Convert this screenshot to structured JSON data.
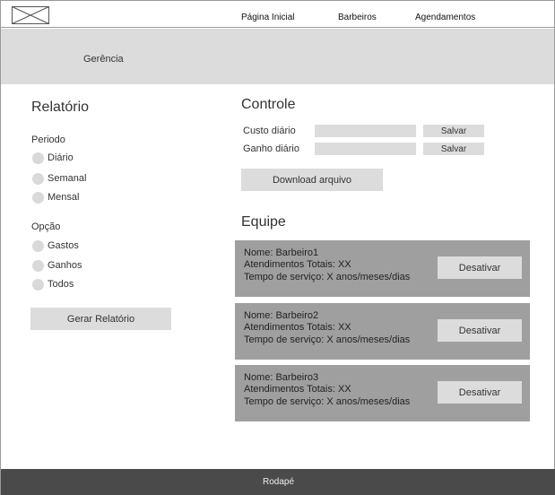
{
  "nav": {
    "links": [
      "Página Inicial",
      "Barbeiros",
      "Agendamentos"
    ]
  },
  "banner": {
    "title": "Gerência"
  },
  "report": {
    "title": "Relatório",
    "period_label": "Periodo",
    "period_options": [
      "Diário",
      "Semanal",
      "Mensal"
    ],
    "option_label": "Opção",
    "option_options": [
      "Gastos",
      "Ganhos",
      "Todos"
    ],
    "generate_button": "Gerar Relatório"
  },
  "control": {
    "title": "Controle",
    "daily_cost_label": "Custo diário",
    "daily_gain_label": "Ganho diário",
    "save_label": "Salvar",
    "download_button": "Download arquivo"
  },
  "team": {
    "title": "Equipe",
    "members": [
      {
        "name": "Nome: Barbeiro1",
        "attendances": "Atendimentos Totais: XX",
        "service_time": "Tempo de serviço: X anos/meses/dias",
        "button": "Desativar"
      },
      {
        "name": "Nome: Barbeiro2",
        "attendances": "Atendimentos Totais: XX",
        "service_time": "Tempo de serviço: X anos/meses/dias",
        "button": "Desativar"
      },
      {
        "name": "Nome: Barbeiro3",
        "attendances": "Atendimentos Totais: XX",
        "service_time": "Tempo de serviço: X anos/meses/dias",
        "button": "Desativar"
      }
    ]
  },
  "footer": {
    "text": "Rodapé"
  },
  "colors": {
    "placeholder_gray": "#dcdcdc",
    "card_gray": "#9f9f9f",
    "footer_dark": "#4a4a4a"
  }
}
